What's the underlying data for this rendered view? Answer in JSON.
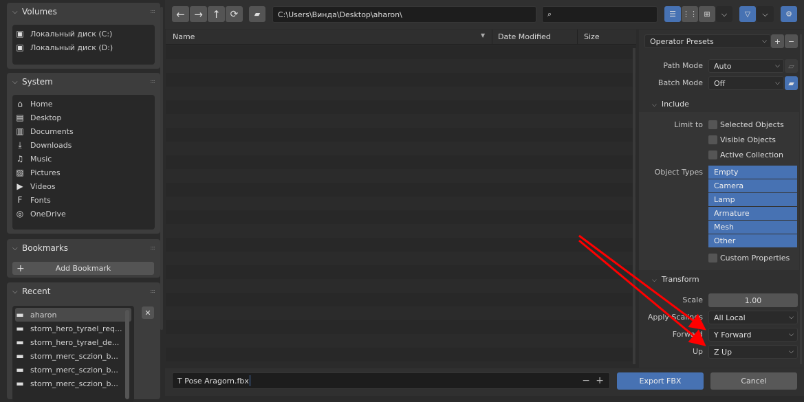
{
  "sidebar": {
    "volumes": {
      "title": "Volumes",
      "items": [
        "Локальный диск (C:)",
        "Локальный диск (D:)"
      ]
    },
    "system": {
      "title": "System",
      "items": [
        {
          "label": "Home",
          "icon": "⌂"
        },
        {
          "label": "Desktop",
          "icon": "▤"
        },
        {
          "label": "Documents",
          "icon": "▥"
        },
        {
          "label": "Downloads",
          "icon": "⤓"
        },
        {
          "label": "Music",
          "icon": "♫"
        },
        {
          "label": "Pictures",
          "icon": "▨"
        },
        {
          "label": "Videos",
          "icon": "▶"
        },
        {
          "label": "Fonts",
          "icon": "F"
        },
        {
          "label": "OneDrive",
          "icon": "◎"
        }
      ]
    },
    "bookmarks": {
      "title": "Bookmarks",
      "add_label": "Add Bookmark"
    },
    "recent": {
      "title": "Recent",
      "items": [
        "aharon",
        "storm_hero_tyrael_req...",
        "storm_hero_tyrael_de...",
        "storm_merc_sczion_b...",
        "storm_merc_sczion_b...",
        "storm_merc_sczion_b..."
      ]
    }
  },
  "toolbar": {
    "path": "C:\\Users\\Винда\\Desktop\\aharon\\",
    "search_placeholder": ""
  },
  "columns": {
    "name": "Name",
    "date": "Date Modified",
    "size": "Size"
  },
  "footer": {
    "filename": "T Pose Aragorn.fbx",
    "export_label": "Export FBX",
    "cancel_label": "Cancel"
  },
  "props": {
    "presets": "Operator Presets",
    "path_mode_label": "Path Mode",
    "path_mode": "Auto",
    "batch_mode_label": "Batch Mode",
    "batch_mode": "Off",
    "include": "Include",
    "limit_to": "Limit to",
    "limit_options": [
      "Selected Objects",
      "Visible Objects",
      "Active Collection"
    ],
    "object_types_label": "Object Types",
    "object_types": [
      "Empty",
      "Camera",
      "Lamp",
      "Armature",
      "Mesh",
      "Other"
    ],
    "custom_props": "Custom Properties",
    "transform": "Transform",
    "scale_label": "Scale",
    "scale": "1.00",
    "apply_label": "Apply Scalings",
    "apply": "All Local",
    "forward_label": "Forward",
    "forward": "Y Forward",
    "up_label": "Up",
    "up": "Z Up"
  },
  "colors": {
    "accent": "#4772b3",
    "annotation": "#ff0000"
  }
}
